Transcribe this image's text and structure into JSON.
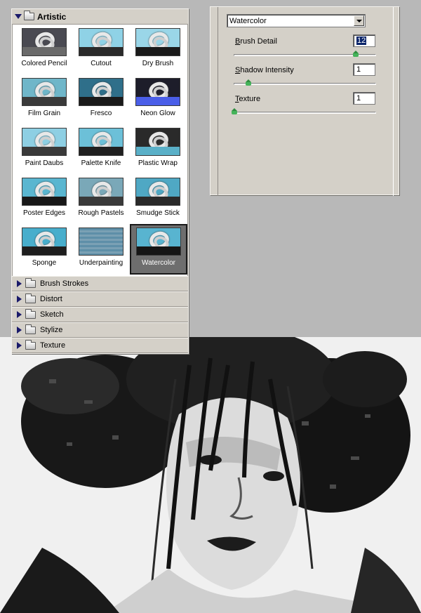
{
  "gallery": {
    "open_category": "Artistic",
    "thumbnails": [
      {
        "label": "Colored Pencil",
        "bg": "#4a4a52",
        "ground": "#6a6a6a"
      },
      {
        "label": "Cutout",
        "bg": "#8fd2e6",
        "ground": "#2a2a2a"
      },
      {
        "label": "Dry Brush",
        "bg": "#9ad6e8",
        "ground": "#1a1a1a"
      },
      {
        "label": "Film Grain",
        "bg": "#6fb6c9",
        "ground": "#3a3a3a"
      },
      {
        "label": "Fresco",
        "bg": "#2f6f8a",
        "ground": "#1a1a1a"
      },
      {
        "label": "Neon Glow",
        "bg": "#1d1d2a",
        "ground": "#4a5ee8"
      },
      {
        "label": "Paint Daubs",
        "bg": "#8ecfe3",
        "ground": "#3a3a3a"
      },
      {
        "label": "Palette Knife",
        "bg": "#6cc0d8",
        "ground": "#202020"
      },
      {
        "label": "Plastic Wrap",
        "bg": "#2a2a2a",
        "ground": "#5ab0c8"
      },
      {
        "label": "Poster Edges",
        "bg": "#5ab6d0",
        "ground": "#181818"
      },
      {
        "label": "Rough Pastels",
        "bg": "#7aa8b8",
        "ground": "#3a3a3a"
      },
      {
        "label": "Smudge Stick",
        "bg": "#4fa8c4",
        "ground": "#2a2a2a"
      },
      {
        "label": "Sponge",
        "bg": "#48aecc",
        "ground": "#1e1e1e"
      },
      {
        "label": "Underpainting",
        "bg": "#5e8fa8",
        "ground": "#7aa0b4"
      },
      {
        "label": "Watercolor",
        "bg": "#58b4d0",
        "ground": "#151515"
      }
    ],
    "selected_label": "Watercolor",
    "collapsed_categories": [
      "Brush Strokes",
      "Distort",
      "Sketch",
      "Stylize",
      "Texture"
    ]
  },
  "settings": {
    "filter_select": "Watercolor",
    "params": [
      {
        "label_prefix": "B",
        "label_rest": "rush Detail",
        "value": "12",
        "slider": 0.86
      },
      {
        "label_prefix": "S",
        "label_rest": "hadow Intensity",
        "value": "1",
        "slider": 0.1
      },
      {
        "label_prefix": "T",
        "label_rest": "exture",
        "value": "1",
        "slider": 0.0
      }
    ]
  }
}
